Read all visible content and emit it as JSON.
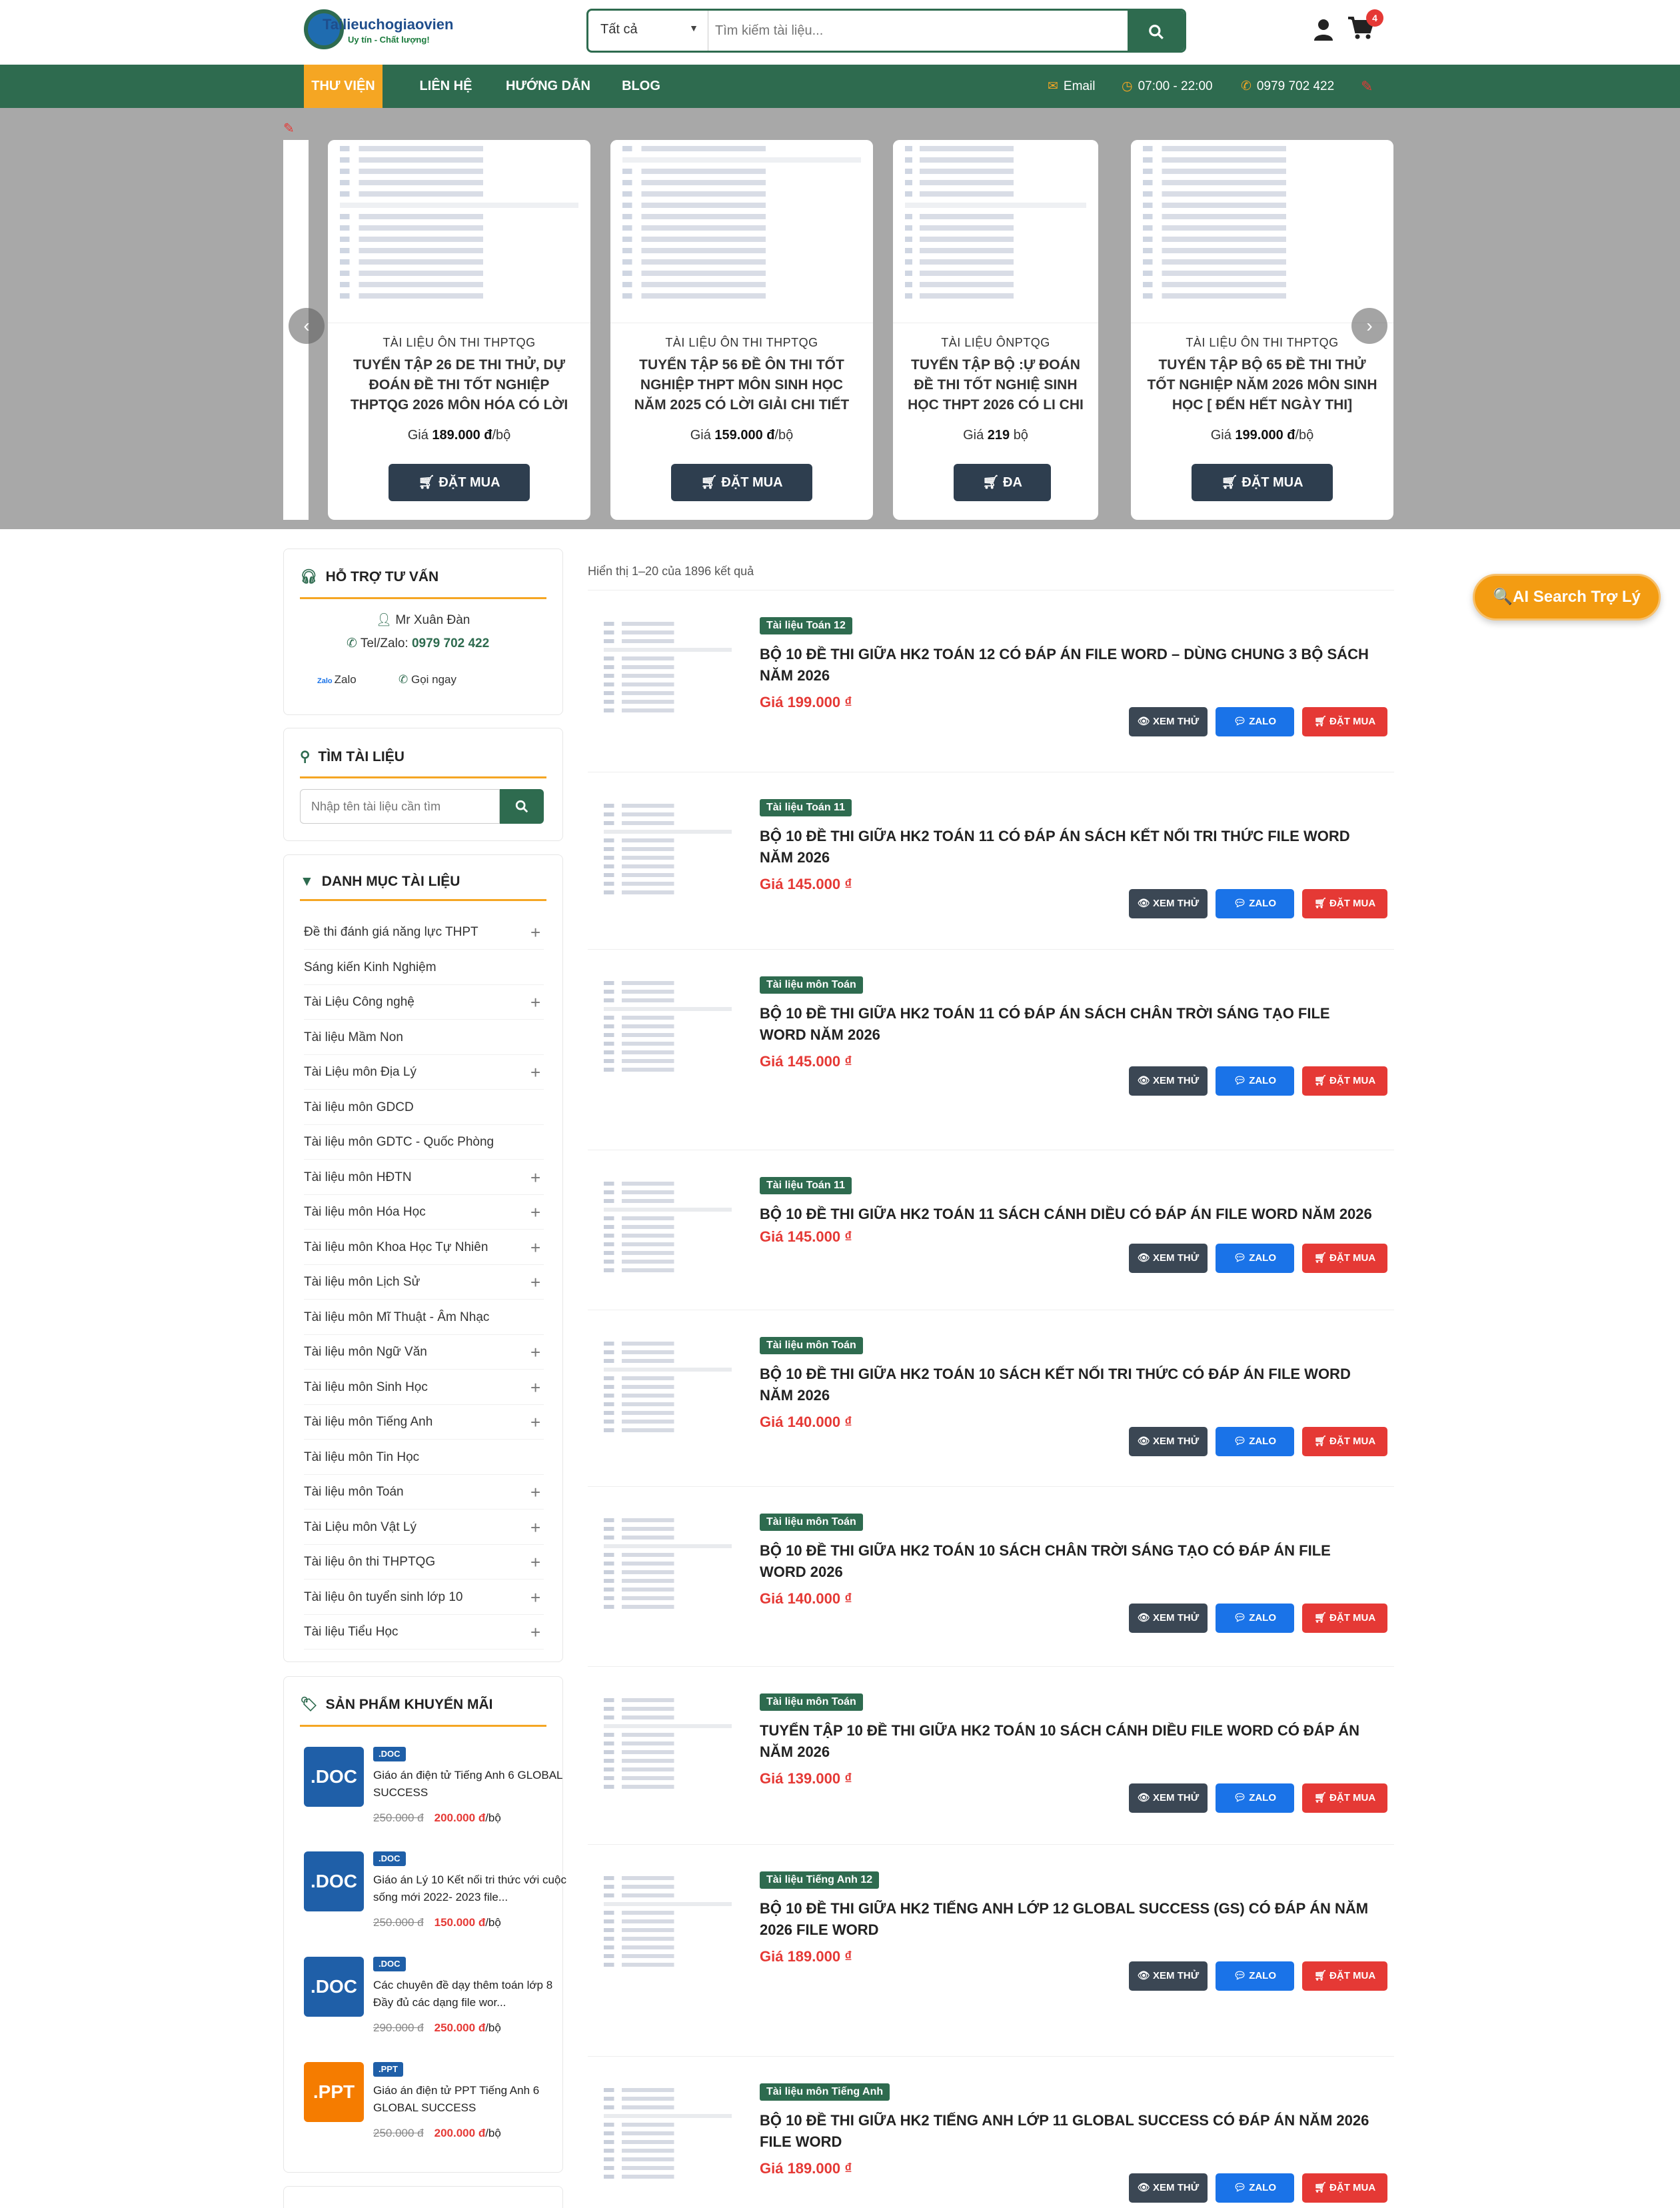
{
  "header": {
    "logo_name": "Tailieuchogiaovien",
    "logo_slogan": "Uy tín - Chất lượng!",
    "search_category": "Tất cả",
    "search_placeholder": "Tìm kiếm tài liệu...",
    "cart_count": "4"
  },
  "nav": {
    "items": [
      "THƯ VIỆN",
      "LIÊN HỆ",
      "HƯỚNG DẪN",
      "BLOG"
    ],
    "email": "Email",
    "hours": "07:00 - 22:00",
    "phone": "0979 702 422"
  },
  "carousel": {
    "cards": [
      {
        "category": "TÀI LIỆU ÔN THI THPTQG",
        "title": "TUYỂN TẬP 26 DE THI THỬ, DỰ ĐOÁN ĐỀ THI TỐT NGHIỆP THPTQG 2026 MÔN HÓA CÓ LỜI GIẢI CHI...",
        "price_label": "Giá",
        "price": "189.000 đ",
        "unit": "/bộ",
        "button": "ĐẶT MUA"
      },
      {
        "category": "TÀI LIỆU ÔN THI THPTQG",
        "title": "TUYỂN TẬP 56 ĐỀ ÔN THI TỐT NGHIỆP THPT MÔN SINH HỌC NĂM 2025 CÓ LỜI GIẢI CHI TIẾT FILE...",
        "price_label": "Giá",
        "price": "159.000 đ",
        "unit": "/bộ",
        "button": "ĐẶT MUA"
      },
      {
        "category": "TÀI LIỆU ÔNPTQG",
        "title": "TUYỂN TẬP BỘ :Ự ĐOÁN ĐỀ THI TỐT NGHIỆ SINH HỌC THPT 2026 CÓ LI CHI TIẾT ...",
        "price_label": "Giá",
        "price": "219",
        "unit": "bộ",
        "button": "ĐA"
      },
      {
        "category": "TÀI LIỆU ÔN THI THPTQG",
        "title": "TUYỂN TẬP BỘ 65 ĐỀ THI THỬ TỐT NGHIỆP NĂM 2026 MÔN SINH HỌC [ ĐẾN HẾT NGÀY THI]",
        "price_label": "Giá",
        "price": "199.000 đ",
        "unit": "/bộ",
        "button": "ĐẶT MUA"
      }
    ]
  },
  "support": {
    "title": "HỖ TRỢ TƯ VẤN",
    "name": "Mr Xuân Đàn",
    "tel_label": "Tel/Zalo:",
    "tel": "0979 702 422",
    "zalo": "Zalo",
    "call": "Gọi ngay"
  },
  "find": {
    "title": "TÌM TÀI LIỆU",
    "placeholder": "Nhập tên tài liệu cần tìm"
  },
  "categories": {
    "title": "DANH MỤC TÀI LIỆU",
    "items": [
      "Đề thi đánh giá năng lực THPT",
      "Sáng kiến Kinh Nghiệm",
      "Tài Liệu Công nghệ",
      "Tài liệu Mầm Non",
      "Tài Liệu môn Địa Lý",
      "Tài liệu môn GDCD",
      "Tài liệu môn GDTC - Quốc Phòng",
      "Tài liệu môn HĐTN",
      "Tài liệu môn Hóa Học",
      "Tài liệu môn Khoa Học Tự Nhiên",
      "Tài liệu môn Lịch Sử",
      "Tài liệu môn Mĩ Thuật - Âm Nhạc",
      "Tài liệu môn Ngữ Văn",
      "Tài liệu môn Sinh Học",
      "Tài liệu môn Tiếng Anh",
      "Tài liệu môn Tin Học",
      "Tài liệu môn Toán",
      "Tài Liệu môn Vật Lý",
      "Tài liệu ôn thi THPTQG",
      "Tài liệu ôn tuyển sinh lớp 10",
      "Tài liệu Tiểu Học"
    ]
  },
  "promos": {
    "title": "SẢN PHẨM KHUYẾN MÃI",
    "items": [
      {
        "file": ".DOC",
        "tag": ".DOC",
        "name": "Giáo án điện tử Tiếng Anh 6 GLOBAL SUCCESS",
        "old": "250.000 đ",
        "new": "200.000 đ",
        "unit": "/bộ"
      },
      {
        "file": ".DOC",
        "tag": ".DOC",
        "name": "Giáo án Lý 10 Kết nối tri thức với cuộc sống mới 2022- 2023 file...",
        "old": "250.000 đ",
        "new": "150.000 đ",
        "unit": "/bộ"
      },
      {
        "file": ".DOC",
        "tag": ".DOC",
        "name": "Các chuyên đề dạy thêm toán lớp 8 Đầy đủ các dạng file wor...",
        "old": "290.000 đ",
        "new": "250.000 đ",
        "unit": "/bộ"
      },
      {
        "file": ".PPT",
        "tag": ".PPT",
        "name": "Giáo án điện tử PPT Tiếng Anh 6 GLOBAL SUCCESS",
        "old": "250.000 đ",
        "new": "200.000 đ",
        "unit": "/bộ"
      }
    ]
  },
  "results": {
    "count_text": "Hiển thị 1–20 của 1896 kết quả",
    "btn_view": "XEM THỬ",
    "btn_zalo": "ZALO",
    "btn_buy": "ĐẶT MUA",
    "items": [
      {
        "tag": "Tài liệu Toán 12",
        "title": "BỘ 10 ĐỀ THI GIỮA HK2 TOÁN 12 CÓ ĐÁP ÁN FILE WORD – DÙNG CHUNG 3 BỘ SÁCH NĂM 2026",
        "price": "Giá 199.000 ₫"
      },
      {
        "tag": "Tài liệu Toán 11",
        "title": "BỘ 10 ĐỀ THI GIỮA HK2 TOÁN 11 CÓ ĐÁP ÁN SÁCH KẾT NỐI TRI THỨC FILE WORD NĂM 2026",
        "price": "Giá 145.000 ₫"
      },
      {
        "tag": "Tài liệu môn Toán",
        "title": "BỘ 10 ĐỀ THI GIỮA HK2 TOÁN 11 CÓ ĐÁP ÁN SÁCH CHÂN TRỜI SÁNG TẠO FILE WORD NĂM 2026",
        "price": "Giá 145.000 ₫"
      },
      {
        "tag": "Tài liệu Toán 11",
        "title": "BỘ 10 ĐỀ THI GIỮA HK2 TOÁN 11 SÁCH CÁNH DIỀU CÓ ĐÁP ÁN FILE WORD NĂM 2026",
        "price": "Giá 145.000 ₫"
      },
      {
        "tag": "Tài liệu môn Toán",
        "title": "BỘ 10 ĐỀ THI GIỮA HK2 TOÁN 10 SÁCH KẾT NỐI TRI THỨC CÓ ĐÁP ÁN FILE WORD NĂM 2026",
        "price": "Giá 140.000 ₫"
      },
      {
        "tag": "Tài liệu môn Toán",
        "title": "BỘ 10 ĐỀ THI GIỮA HK2 TOÁN 10 SÁCH CHÂN TRỜI SÁNG TẠO CÓ ĐÁP ÁN FILE WORD 2026",
        "price": "Giá 140.000 ₫"
      },
      {
        "tag": "Tài liệu môn Toán",
        "title": "TUYỂN TẬP 10 ĐỀ THI GIỮA HK2 TOÁN 10 SÁCH CÁNH DIỀU FILE WORD CÓ ĐÁP ÁN NĂM 2026",
        "price": "Giá 139.000 ₫"
      },
      {
        "tag": "Tài liệu Tiếng Anh 12",
        "title": "BỘ 10 ĐỀ THI GIỮA HK2 TIẾNG ANH LỚP 12 GLOBAL SUCCESS (GS) CÓ ĐÁP ÁN NĂM 2026 FILE WORD",
        "price": "Giá 189.000 ₫"
      },
      {
        "tag": "Tài liệu môn Tiếng Anh",
        "title": "BỘ 10 ĐỀ THI GIỮA HK2 TIẾNG ANH LỚP 11 GLOBAL SUCCESS CÓ ĐÁP ÁN NĂM 2026 FILE WORD",
        "price": "Giá 189.000 ₫"
      }
    ]
  },
  "ai_search": "🔍AI Search Trợ Lý",
  "colors": {
    "primary": "#2e6b4f",
    "accent": "#f5a623",
    "price": "#e53935",
    "zalo": "#1a73e8"
  }
}
